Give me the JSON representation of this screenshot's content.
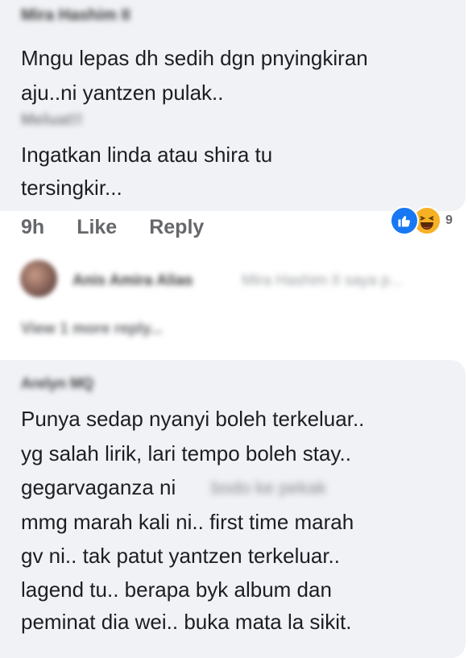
{
  "comment1": {
    "author": "Mira Hashim II",
    "text_line1": "Mngu lepas dh sedih dgn pnyingkiran",
    "text_line2": "aju..ni yantzen pulak..",
    "reply_mention": "Meluat!!",
    "text_line3": "Ingatkan linda atau shira tu",
    "text_line4": "tersingkir...",
    "time": "9h",
    "like_label": "Like",
    "reply_label": "Reply",
    "reaction_count": "9",
    "reaction_icons": [
      "like-icon",
      "haha-icon"
    ]
  },
  "reply_preview": {
    "author": "Anis Amira Alias",
    "mention": "Mira Hashim II saya p...",
    "view_more": "View 1 more reply..."
  },
  "comment2": {
    "author": "Arelyn MQ",
    "line1": "Punya sedap nyanyi boleh terkeluar..",
    "line2": "yg salah lirik, lari tempo boleh stay..",
    "line3": "gegarvaganza ni",
    "line3_blur": "bodo ke pekak",
    "line4": "mmg marah kali ni.. first time marah",
    "line5": "gv ni.. tak patut yantzen terkeluar..",
    "line6": "lagend tu.. berapa byk album dan",
    "line7": "peminat dia wei.. buka mata la sikit."
  },
  "colors": {
    "bubble": "#f0f2f5",
    "meta": "#65676b",
    "like_blue": "#1877f2",
    "haha_yellow": "#f7b125"
  }
}
